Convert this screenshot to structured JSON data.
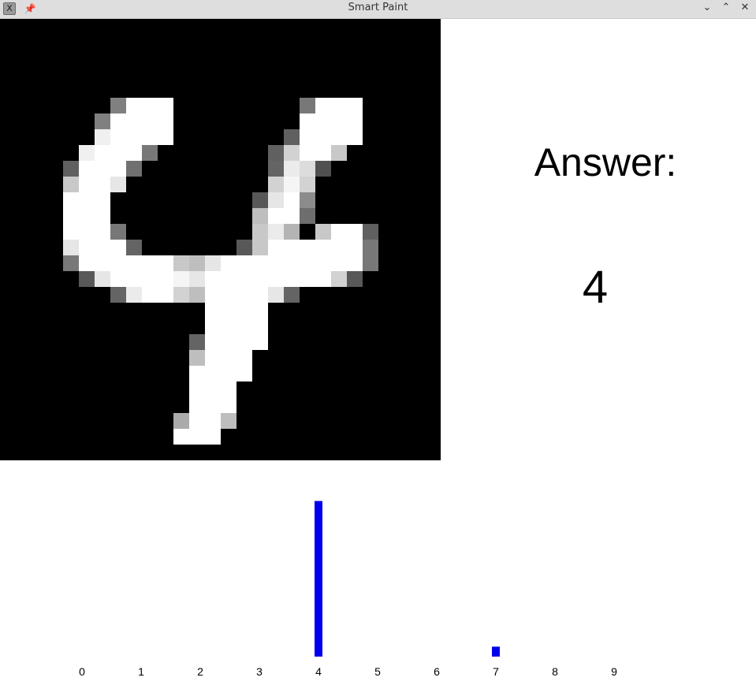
{
  "window": {
    "title": "Smart Paint",
    "app_icon_glyph": "X",
    "icons": [
      "app-icon",
      "pin-icon",
      "minimize-icon",
      "maximize-icon",
      "close-icon"
    ]
  },
  "canvas": {
    "background": "#000000",
    "grid_size": 28,
    "pixels": [
      [
        7,
        5,
        128
      ],
      [
        8,
        5,
        255
      ],
      [
        9,
        5,
        255
      ],
      [
        10,
        5,
        255
      ],
      [
        19,
        5,
        120
      ],
      [
        20,
        5,
        255
      ],
      [
        21,
        5,
        255
      ],
      [
        22,
        5,
        255
      ],
      [
        6,
        6,
        128
      ],
      [
        7,
        6,
        255
      ],
      [
        8,
        6,
        255
      ],
      [
        9,
        6,
        255
      ],
      [
        10,
        6,
        255
      ],
      [
        19,
        6,
        255
      ],
      [
        20,
        6,
        255
      ],
      [
        21,
        6,
        255
      ],
      [
        22,
        6,
        255
      ],
      [
        6,
        7,
        240
      ],
      [
        7,
        7,
        255
      ],
      [
        8,
        7,
        255
      ],
      [
        9,
        7,
        255
      ],
      [
        10,
        7,
        255
      ],
      [
        18,
        7,
        96
      ],
      [
        19,
        7,
        255
      ],
      [
        20,
        7,
        255
      ],
      [
        21,
        7,
        255
      ],
      [
        22,
        7,
        255
      ],
      [
        5,
        8,
        240
      ],
      [
        6,
        8,
        255
      ],
      [
        7,
        8,
        255
      ],
      [
        8,
        8,
        255
      ],
      [
        9,
        8,
        120
      ],
      [
        17,
        8,
        96
      ],
      [
        18,
        8,
        210
      ],
      [
        19,
        8,
        255
      ],
      [
        20,
        8,
        255
      ],
      [
        21,
        8,
        200
      ],
      [
        4,
        9,
        96
      ],
      [
        5,
        9,
        255
      ],
      [
        6,
        9,
        255
      ],
      [
        7,
        9,
        255
      ],
      [
        8,
        9,
        112
      ],
      [
        17,
        9,
        100
      ],
      [
        18,
        9,
        235
      ],
      [
        19,
        9,
        220
      ],
      [
        20,
        9,
        80
      ],
      [
        4,
        10,
        200
      ],
      [
        5,
        10,
        255
      ],
      [
        6,
        10,
        255
      ],
      [
        7,
        10,
        230
      ],
      [
        17,
        10,
        210
      ],
      [
        18,
        10,
        245
      ],
      [
        19,
        10,
        210
      ],
      [
        4,
        11,
        255
      ],
      [
        5,
        11,
        255
      ],
      [
        6,
        11,
        255
      ],
      [
        16,
        11,
        88
      ],
      [
        17,
        11,
        230
      ],
      [
        18,
        11,
        255
      ],
      [
        19,
        11,
        140
      ],
      [
        4,
        12,
        255
      ],
      [
        5,
        12,
        255
      ],
      [
        6,
        12,
        255
      ],
      [
        16,
        12,
        190
      ],
      [
        17,
        12,
        255
      ],
      [
        18,
        12,
        255
      ],
      [
        19,
        12,
        110
      ],
      [
        4,
        13,
        255
      ],
      [
        5,
        13,
        255
      ],
      [
        6,
        13,
        255
      ],
      [
        7,
        13,
        120
      ],
      [
        16,
        13,
        200
      ],
      [
        17,
        13,
        235
      ],
      [
        18,
        13,
        180
      ],
      [
        20,
        13,
        200
      ],
      [
        21,
        13,
        255
      ],
      [
        22,
        13,
        255
      ],
      [
        23,
        13,
        96
      ],
      [
        4,
        14,
        230
      ],
      [
        5,
        14,
        255
      ],
      [
        6,
        14,
        255
      ],
      [
        7,
        14,
        255
      ],
      [
        8,
        14,
        100
      ],
      [
        15,
        14,
        88
      ],
      [
        16,
        14,
        200
      ],
      [
        17,
        14,
        255
      ],
      [
        18,
        14,
        255
      ],
      [
        19,
        14,
        255
      ],
      [
        20,
        14,
        255
      ],
      [
        21,
        14,
        255
      ],
      [
        22,
        14,
        255
      ],
      [
        23,
        14,
        120
      ],
      [
        4,
        15,
        120
      ],
      [
        5,
        15,
        255
      ],
      [
        6,
        15,
        255
      ],
      [
        7,
        15,
        255
      ],
      [
        8,
        15,
        255
      ],
      [
        9,
        15,
        255
      ],
      [
        10,
        15,
        255
      ],
      [
        11,
        15,
        200
      ],
      [
        12,
        15,
        190
      ],
      [
        13,
        15,
        230
      ],
      [
        14,
        15,
        255
      ],
      [
        15,
        15,
        255
      ],
      [
        16,
        15,
        255
      ],
      [
        17,
        15,
        255
      ],
      [
        18,
        15,
        255
      ],
      [
        19,
        15,
        255
      ],
      [
        20,
        15,
        255
      ],
      [
        21,
        15,
        255
      ],
      [
        22,
        15,
        255
      ],
      [
        23,
        15,
        120
      ],
      [
        5,
        16,
        88
      ],
      [
        6,
        16,
        230
      ],
      [
        7,
        16,
        255
      ],
      [
        8,
        16,
        255
      ],
      [
        9,
        16,
        255
      ],
      [
        10,
        16,
        255
      ],
      [
        11,
        16,
        245
      ],
      [
        12,
        16,
        230
      ],
      [
        13,
        16,
        255
      ],
      [
        14,
        16,
        255
      ],
      [
        15,
        16,
        255
      ],
      [
        16,
        16,
        255
      ],
      [
        17,
        16,
        255
      ],
      [
        18,
        16,
        255
      ],
      [
        19,
        16,
        255
      ],
      [
        20,
        16,
        255
      ],
      [
        21,
        16,
        210
      ],
      [
        22,
        16,
        88
      ],
      [
        7,
        17,
        100
      ],
      [
        8,
        17,
        235
      ],
      [
        9,
        17,
        255
      ],
      [
        10,
        17,
        255
      ],
      [
        11,
        17,
        210
      ],
      [
        12,
        17,
        190
      ],
      [
        13,
        17,
        255
      ],
      [
        14,
        17,
        255
      ],
      [
        15,
        17,
        255
      ],
      [
        16,
        17,
        255
      ],
      [
        17,
        17,
        230
      ],
      [
        18,
        17,
        100
      ],
      [
        13,
        18,
        255
      ],
      [
        14,
        18,
        255
      ],
      [
        15,
        18,
        255
      ],
      [
        16,
        18,
        255
      ],
      [
        13,
        19,
        255
      ],
      [
        14,
        19,
        255
      ],
      [
        15,
        19,
        255
      ],
      [
        16,
        19,
        255
      ],
      [
        12,
        20,
        100
      ],
      [
        13,
        20,
        255
      ],
      [
        14,
        20,
        255
      ],
      [
        15,
        20,
        255
      ],
      [
        16,
        20,
        255
      ],
      [
        12,
        21,
        190
      ],
      [
        13,
        21,
        255
      ],
      [
        14,
        21,
        255
      ],
      [
        15,
        21,
        255
      ],
      [
        12,
        22,
        255
      ],
      [
        13,
        22,
        255
      ],
      [
        14,
        22,
        255
      ],
      [
        15,
        22,
        255
      ],
      [
        12,
        23,
        255
      ],
      [
        13,
        23,
        255
      ],
      [
        14,
        23,
        255
      ],
      [
        12,
        24,
        255
      ],
      [
        13,
        24,
        255
      ],
      [
        14,
        24,
        255
      ],
      [
        11,
        25,
        170
      ],
      [
        12,
        25,
        255
      ],
      [
        13,
        25,
        255
      ],
      [
        14,
        25,
        190
      ],
      [
        11,
        26,
        255
      ],
      [
        12,
        26,
        255
      ],
      [
        13,
        26,
        255
      ]
    ]
  },
  "answer": {
    "label": "Answer:",
    "value": "4"
  },
  "chart_data": {
    "type": "bar",
    "bar_color": "#0000ee",
    "categories": [
      "0",
      "1",
      "2",
      "3",
      "4",
      "5",
      "6",
      "7",
      "8",
      "9"
    ],
    "values": [
      0,
      0,
      0,
      0,
      0.94,
      0,
      0,
      0.06,
      0,
      0
    ],
    "ylim": [
      0,
      1
    ],
    "grid": false,
    "title": "",
    "xlabel": "",
    "ylabel": ""
  }
}
